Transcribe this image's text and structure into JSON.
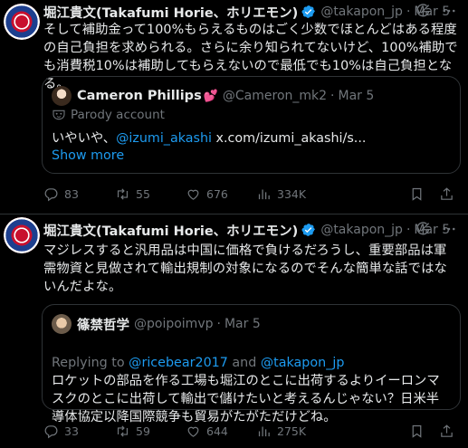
{
  "tweets": [
    {
      "author_name": "堀江貴文(Takafumi Horie、ホリエモン)",
      "author_handle": "@takapon_jp",
      "separator": "·",
      "date": "Mar 5",
      "text": "そして補助金って100%もらえるものはごく少数でほとんどはある程度の自己負担を求められる。さらに余り知られてないけど、100%補助でも消費税10%は補助してもらえないので最低でも10%は自己負担となる。",
      "quote": {
        "author_name": "Cameron Phillips",
        "author_badge": "💕",
        "author_handle": "@Cameron_mk2",
        "separator": "·",
        "date": "Mar 5",
        "label": "Parody account",
        "text_prefix": "いやいや、",
        "text_mention": "@izumi_akashi",
        "text_link": " x.com/izumi_akashi/s...",
        "show_more": "Show more"
      },
      "counts": {
        "replies": "83",
        "retweets": "55",
        "likes": "676",
        "views": "334K"
      }
    },
    {
      "author_name": "堀江貴文(Takafumi Horie、ホリエモン)",
      "author_handle": "@takapon_jp",
      "separator": "·",
      "date": "Mar 5",
      "text": "マジレスすると汎用品は中国に価格で負けるだろうし、重要部品は軍需物資と見做されて輸出規制の対象になるのでそんな簡単な話ではないんだよな。",
      "quote": {
        "author_name": "篠禁哲学",
        "author_handle": "@poipoimvp",
        "separator": "·",
        "date": "Mar 5",
        "replying_prefix": "Replying to ",
        "replying_mention_1": "@ricebear2017",
        "replying_and": " and ",
        "replying_mention_2": "@takapon_jp",
        "text": "ロケットの部品を作る工場も堀江のとこに出荷するよりイーロンマスクのとこに出荷して輸出で儲けたいと考えるんじゃない？日米半導体協定以降国際競争も貿易がたがただけどね。"
      },
      "counts": {
        "replies": "33",
        "retweets": "59",
        "likes": "644",
        "views": "275K"
      }
    }
  ],
  "colors": {
    "background": "#000000",
    "text": "#e7e9ea",
    "muted": "#71767b",
    "accent": "#1d9bf0",
    "border": "#2f3336",
    "verified": "#1d9bf0"
  }
}
